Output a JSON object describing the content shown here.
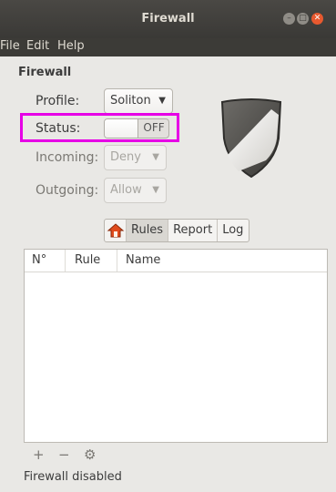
{
  "window": {
    "title": "Firewall"
  },
  "menu": [
    "File",
    "Edit",
    "Help"
  ],
  "section_heading": "Firewall",
  "profile": {
    "label": "Profile:",
    "value": "Soliton"
  },
  "status": {
    "label": "Status:",
    "switch_state": "OFF"
  },
  "incoming": {
    "label": "Incoming:",
    "value": "Deny"
  },
  "outgoing": {
    "label": "Outgoing:",
    "value": "Allow"
  },
  "tabs": [
    "Rules",
    "Report",
    "Log"
  ],
  "table": {
    "columns": [
      "N°",
      "Rule",
      "Name"
    ],
    "rows": []
  },
  "footer_buttons": [
    "+",
    "−",
    "⚙"
  ],
  "status_bar": "Firewall disabled",
  "colors": {
    "highlight": "#e600e6",
    "close_button": "#e8592f",
    "titlebar": "#3c3b37"
  },
  "icons": [
    "minimize-icon",
    "maximize-icon",
    "close-icon",
    "shield-icon",
    "home-icon",
    "gear-icon"
  ]
}
